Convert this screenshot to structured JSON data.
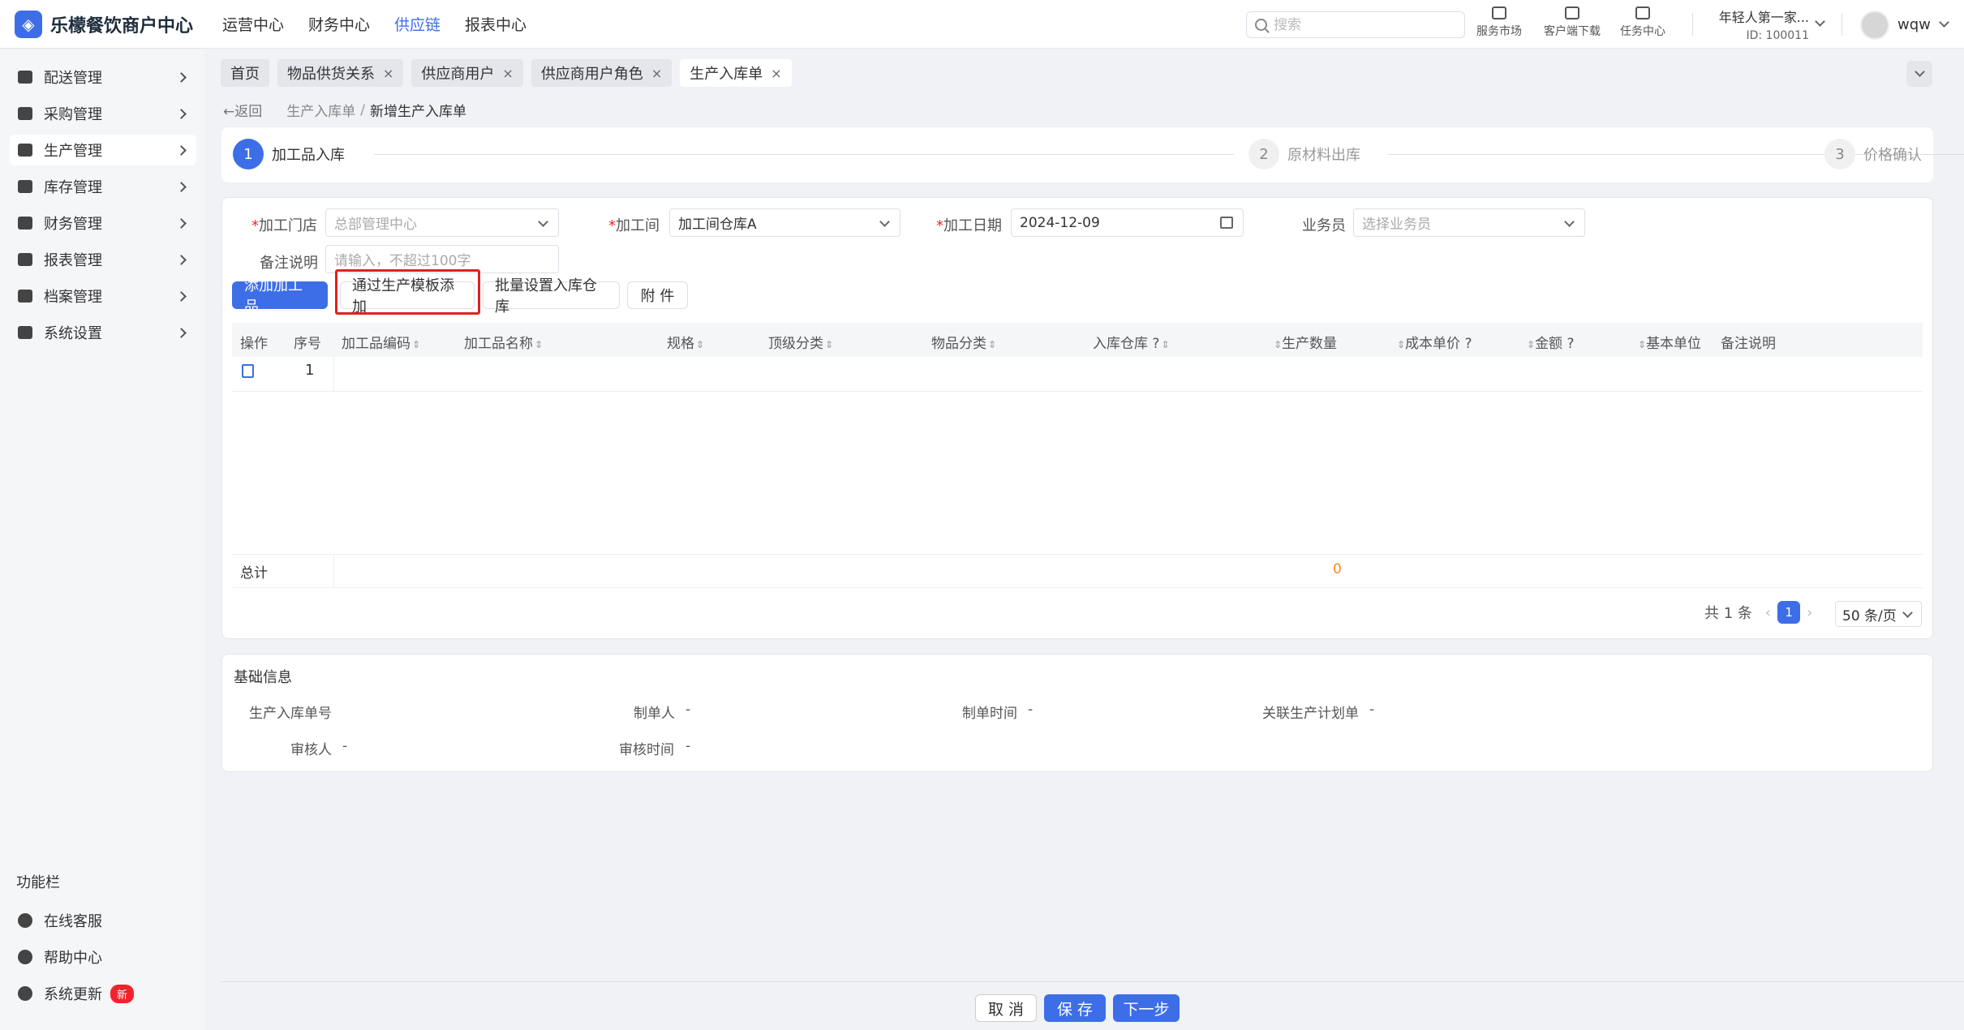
{
  "app": {
    "title": "乐檬餐饮商户中心",
    "logo_glyph": "◈",
    "accent": "#3d6ee8"
  },
  "topnav": [
    "运营中心",
    "财务中心",
    "供应链",
    "报表中心"
  ],
  "topnav_active": 2,
  "search": {
    "placeholder": "搜索"
  },
  "tools": [
    "服务市场",
    "客户端下载",
    "任务中心"
  ],
  "account": {
    "name": "年轻人第一家...",
    "id": "ID: 100011"
  },
  "user": {
    "name": "wqw"
  },
  "sidebar": {
    "items": [
      {
        "label": "配送管理",
        "icon": "truck-icon"
      },
      {
        "label": "采购管理",
        "icon": "cart-icon"
      },
      {
        "label": "生产管理",
        "icon": "production-icon"
      },
      {
        "label": "库存管理",
        "icon": "warehouse-icon"
      },
      {
        "label": "财务管理",
        "icon": "finance-icon"
      },
      {
        "label": "报表管理",
        "icon": "report-icon"
      },
      {
        "label": "档案管理",
        "icon": "archive-icon"
      },
      {
        "label": "系统设置",
        "icon": "gear-icon"
      }
    ],
    "active_index": 2,
    "func_title": "功能栏",
    "func_items": [
      {
        "label": "在线客服",
        "icon": "headset-icon"
      },
      {
        "label": "帮助中心",
        "icon": "help-icon"
      },
      {
        "label": "系统更新",
        "icon": "refresh-icon",
        "badge": "新"
      }
    ]
  },
  "tabs": [
    {
      "label": "首页",
      "closable": false
    },
    {
      "label": "物品供货关系",
      "closable": true
    },
    {
      "label": "供应商用户",
      "closable": true
    },
    {
      "label": "供应商用户角色",
      "closable": true
    },
    {
      "label": "生产入库单",
      "closable": true
    }
  ],
  "tab_close": "×",
  "breadcrumb": {
    "back": "←返回",
    "prev": "生产入库单",
    "sep": "/",
    "current": "新增生产入库单"
  },
  "steps": [
    {
      "num": "1",
      "label": "加工品入库"
    },
    {
      "num": "2",
      "label": "原材料出库"
    },
    {
      "num": "3",
      "label": "价格确认"
    }
  ],
  "form": {
    "store_label": "加工门店",
    "store_value": "总部管理中心",
    "workshop_label": "加工间",
    "workshop_value": "加工间仓库A",
    "date_label": "加工日期",
    "date_value": "2024-12-09",
    "salesman_label": "业务员",
    "salesman_placeholder": "选择业务员",
    "remark_label": "备注说明",
    "remark_placeholder": "请输入，不超过100字",
    "req_mark": "*"
  },
  "actions": {
    "add": "添加加工品",
    "template": "通过生产模板添加",
    "batch": "批量设置入库仓库",
    "attach": "附 件"
  },
  "table": {
    "columns": [
      "操作",
      "序号",
      "加工品编码",
      "加工品名称",
      "规格",
      "顶级分类",
      "物品分类",
      "入库仓库",
      "生产数量",
      "成本单价",
      "金额",
      "基本单位",
      "备注说明"
    ],
    "sort_mark": "⇕",
    "help_mark": "?",
    "rows": [
      {
        "index": "1"
      }
    ],
    "total_label": "总计",
    "total_value": "0",
    "total_color": "#fa8c16"
  },
  "pagination": {
    "total": "共 1 条",
    "current": "1",
    "size": "50 条/页",
    "prev": "‹",
    "next": "›"
  },
  "info": {
    "title": "基础信息",
    "fields": [
      {
        "label": "生产入库单号",
        "value": ""
      },
      {
        "label": "制单人",
        "value": "-"
      },
      {
        "label": "制单时间",
        "value": "-"
      },
      {
        "label": "关联生产计划单",
        "value": "-"
      },
      {
        "label": "审核人",
        "value": "-"
      },
      {
        "label": "审核时间",
        "value": "-"
      }
    ]
  },
  "footer": {
    "cancel": "取 消",
    "save": "保 存",
    "next": "下一步"
  }
}
